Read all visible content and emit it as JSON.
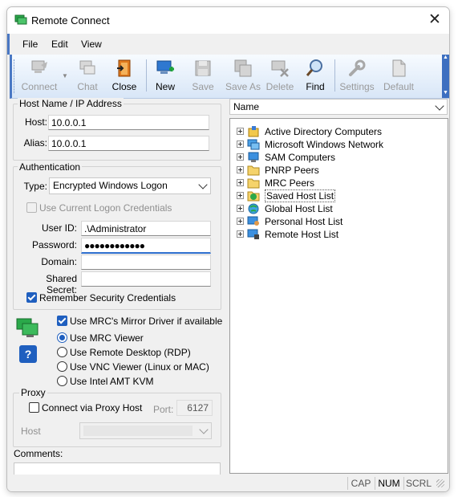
{
  "window": {
    "title": "Remote Connect",
    "close_glyph": "✕"
  },
  "menu": [
    "File",
    "Edit",
    "View"
  ],
  "toolbar": {
    "buttons": [
      {
        "label": "Connect",
        "icon": "connect-icon",
        "enabled": false
      },
      {
        "label": "Chat",
        "icon": "chat-icon",
        "enabled": false
      },
      {
        "label": "Close",
        "icon": "close-door-icon",
        "enabled": true
      },
      {
        "label": "New",
        "icon": "new-icon",
        "enabled": true
      },
      {
        "label": "Save",
        "icon": "save-icon",
        "enabled": false
      },
      {
        "label": "Save As",
        "icon": "save-as-icon",
        "enabled": false
      },
      {
        "label": "Delete",
        "icon": "delete-icon",
        "enabled": false
      },
      {
        "label": "Find",
        "icon": "find-icon",
        "enabled": true
      },
      {
        "label": "Settings",
        "icon": "wrench-icon",
        "enabled": false
      },
      {
        "label": "Default",
        "icon": "default-icon",
        "enabled": false
      }
    ]
  },
  "host": {
    "group_title": "Host Name / IP Address",
    "host_label": "Host:",
    "host_value": "10.0.0.1",
    "alias_label": "Alias:",
    "alias_value": "10.0.0.1"
  },
  "auth": {
    "group_title": "Authentication",
    "type_label": "Type:",
    "type_value": "Encrypted Windows Logon",
    "use_current_label": "Use Current Logon Credentials",
    "userid_label": "User ID:",
    "userid_value": ".\\Administrator",
    "password_label": "Password:",
    "password_value": "●●●●●●●●●●●●",
    "domain_label": "Domain:",
    "domain_value": "",
    "secret_label": "Shared Secret:",
    "secret_value": "",
    "remember_label": "Remember Security Credentials"
  },
  "viewer": {
    "mirror_label": "Use MRC's Mirror Driver if available",
    "options": [
      {
        "label": "Use MRC Viewer",
        "selected": true
      },
      {
        "label": "Use Remote Desktop (RDP)",
        "selected": false
      },
      {
        "label": "Use VNC Viewer (Linux or MAC)",
        "selected": false
      },
      {
        "label": "Use Intel AMT KVM",
        "selected": false
      }
    ],
    "help_glyph": "?"
  },
  "proxy": {
    "group_title": "Proxy",
    "connect_label": "Connect via Proxy Host",
    "port_label": "Port:",
    "port_value": "6127",
    "host_label": "Host"
  },
  "comments": {
    "label": "Comments:"
  },
  "tree": {
    "sort_value": "Name",
    "items": [
      {
        "label": "Active Directory Computers",
        "icon": "active-directory-icon"
      },
      {
        "label": "Microsoft Windows Network",
        "icon": "windows-network-icon"
      },
      {
        "label": "SAM Computers",
        "icon": "sam-computers-icon"
      },
      {
        "label": "PNRP Peers",
        "icon": "folder-icon"
      },
      {
        "label": "MRC Peers",
        "icon": "folder-icon"
      },
      {
        "label": "Saved Host List",
        "icon": "saved-host-icon"
      },
      {
        "label": "Global Host List",
        "icon": "globe-icon"
      },
      {
        "label": "Personal Host List",
        "icon": "personal-host-icon"
      },
      {
        "label": "Remote Host List",
        "icon": "remote-host-icon"
      }
    ]
  },
  "status": [
    "CAP",
    "NUM",
    "SCRL"
  ],
  "colors": {
    "accent": "#1f5fbf",
    "toolbar_edge": "#3d6fc0"
  }
}
